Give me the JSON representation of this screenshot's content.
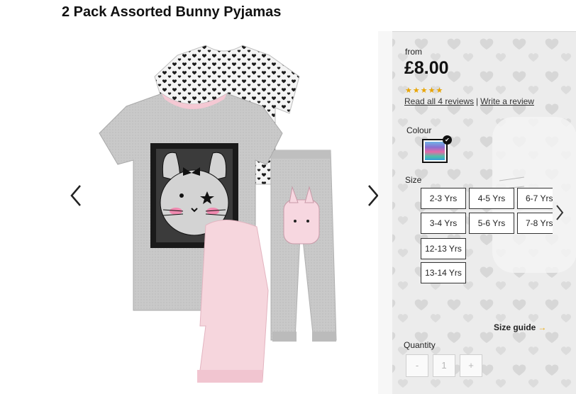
{
  "product": {
    "title": "2 Pack Assorted Bunny Pyjamas"
  },
  "pricing": {
    "from_label": "from",
    "price": "£8.00"
  },
  "rating": {
    "stars": "★★★★★",
    "value": 5,
    "read_reviews": "Read all 4 reviews",
    "separator": "|",
    "write_review": "Write a review"
  },
  "colour": {
    "label": "Colour",
    "selected": "assorted",
    "check": "✔"
  },
  "size": {
    "label": "Size",
    "options": [
      "2-3 Yrs",
      "4-5 Yrs",
      "6-7 Yrs",
      "3-4 Yrs",
      "5-6 Yrs",
      "7-8 Yrs",
      "12-13 Yrs",
      "13-14 Yrs"
    ],
    "guide_label": "Size guide",
    "guide_arrow": "→"
  },
  "quantity": {
    "label": "Quantity",
    "minus": "-",
    "value": "1",
    "plus": "+"
  },
  "icons": {
    "prev": "chevron-left-icon",
    "next": "chevron-right-icon",
    "size_next": "chevron-right-icon"
  },
  "colors": {
    "accent": "#e8a400",
    "text": "#222222"
  }
}
